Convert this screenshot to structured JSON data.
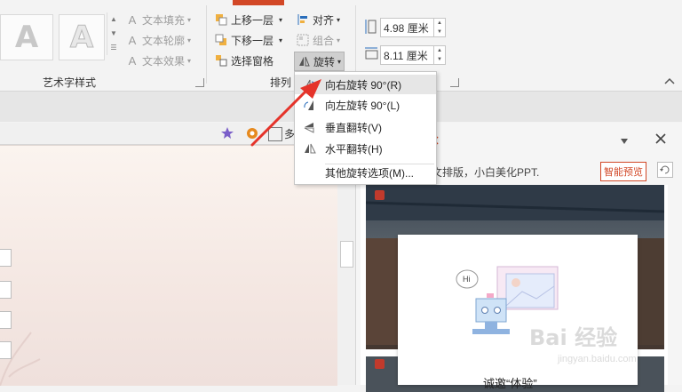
{
  "ribbon": {
    "art_styles": {
      "group_label": "艺术字样式",
      "tile_letter": "A",
      "text_fill": "文本填充",
      "text_outline": "文本轮廓",
      "text_effect": "文本效果"
    },
    "arrange": {
      "group_label": "排列",
      "bring_forward": "上移一层",
      "send_backward": "下移一层",
      "selection_pane": "选择窗格",
      "align": "对齐",
      "group": "组合",
      "rotate": "旋转"
    },
    "size": {
      "height": "4.98 厘米",
      "width": "8.11 厘米"
    }
  },
  "rotate_menu": {
    "items": [
      {
        "label": "向右旋转 90°(R)",
        "icon": "rotate-right-icon"
      },
      {
        "label": "向左旋转 90°(L)",
        "icon": "rotate-left-icon"
      },
      {
        "label": "垂直翻转(V)",
        "icon": "flip-vertical-icon"
      },
      {
        "label": "水平翻转(H)",
        "icon": "flip-horizontal-icon"
      },
      {
        "label": "其他旋转选项(M)...",
        "icon": ""
      }
    ]
  },
  "workspace": {
    "toolbar_label": "多"
  },
  "right_pane": {
    "note_text": "文排版，小白美化PPT.",
    "smart_preview_button": "智能预览",
    "popup_title": "诚邀“体验”",
    "bubble_text": "Hi"
  },
  "watermark": {
    "text": "Bai 经验",
    "url_text": "jingyan.baidu.com"
  },
  "colors": {
    "accent": "#d24726",
    "arrow": "#e5332a",
    "menu_highlight": "#e6e6e6"
  }
}
